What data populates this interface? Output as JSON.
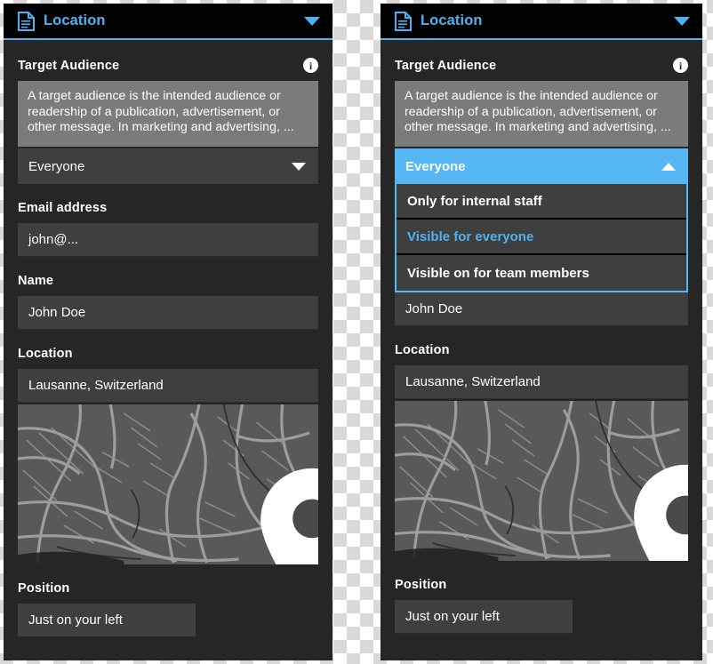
{
  "window": {
    "title": "Location",
    "icon": "document-icon",
    "collapse_icon": "chevron-down-icon",
    "accent_color": "#4db2f2",
    "header_bg": "#000000",
    "panel_bg": "#262626"
  },
  "fields": {
    "target_audience": {
      "label": "Target Audience",
      "info_icon": "info-icon",
      "info_glyph": "i",
      "description": "A target audience is the intended audience or readership of a publication, advertisement, or other message. In marketing and advertising, ..."
    },
    "audience_select": {
      "selected": "Everyone",
      "closed_caret": "chevron-down-icon",
      "open_caret": "chevron-up-icon",
      "options": [
        {
          "label": "Only for internal staff",
          "accent": false
        },
        {
          "label": "Visible for everyone",
          "accent": true
        },
        {
          "label": "Visible on for team members",
          "accent": false
        }
      ]
    },
    "email": {
      "label": "Email address",
      "value": "john@..."
    },
    "name": {
      "label": "Name",
      "value": "John Doe"
    },
    "location": {
      "label": "Location",
      "value": "Lausanne, Switzerland",
      "map_pin_icon": "map-pin-icon"
    },
    "position": {
      "label": "Position",
      "value": "Just on your left"
    }
  },
  "colors": {
    "accent_blue": "#55b6f4",
    "input_bg": "#3f3f3f",
    "description_bg": "#7b7b7b",
    "map_bg": "#595959",
    "map_road": "#b0b0b0"
  }
}
